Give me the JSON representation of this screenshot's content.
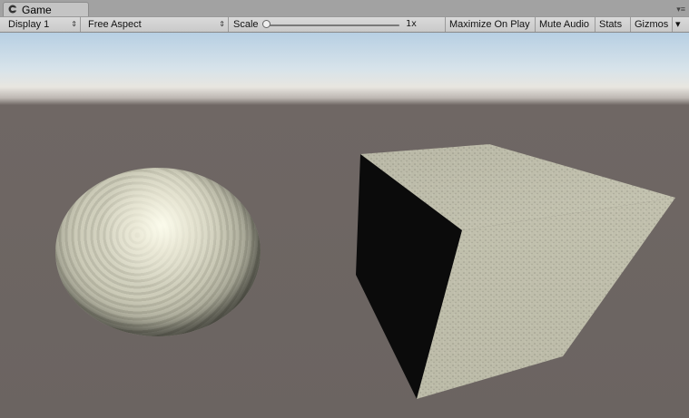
{
  "tab": {
    "title": "Game",
    "icon": "game-controller-icon"
  },
  "window_menu_icon": "window-menu-icon",
  "toolbar": {
    "display": "Display 1",
    "aspect": "Free Aspect",
    "scale_label": "Scale",
    "scale_value": "1x",
    "scale_level": 0,
    "maximize_on_play": "Maximize On Play",
    "mute_audio": "Mute Audio",
    "stats": "Stats",
    "gizmos": "Gizmos"
  },
  "colors": {
    "toolbar_bg": "#cfcfcf",
    "sky": "#c3d7e6",
    "ground": "#6c6462",
    "stone": "#c9c8b4"
  }
}
